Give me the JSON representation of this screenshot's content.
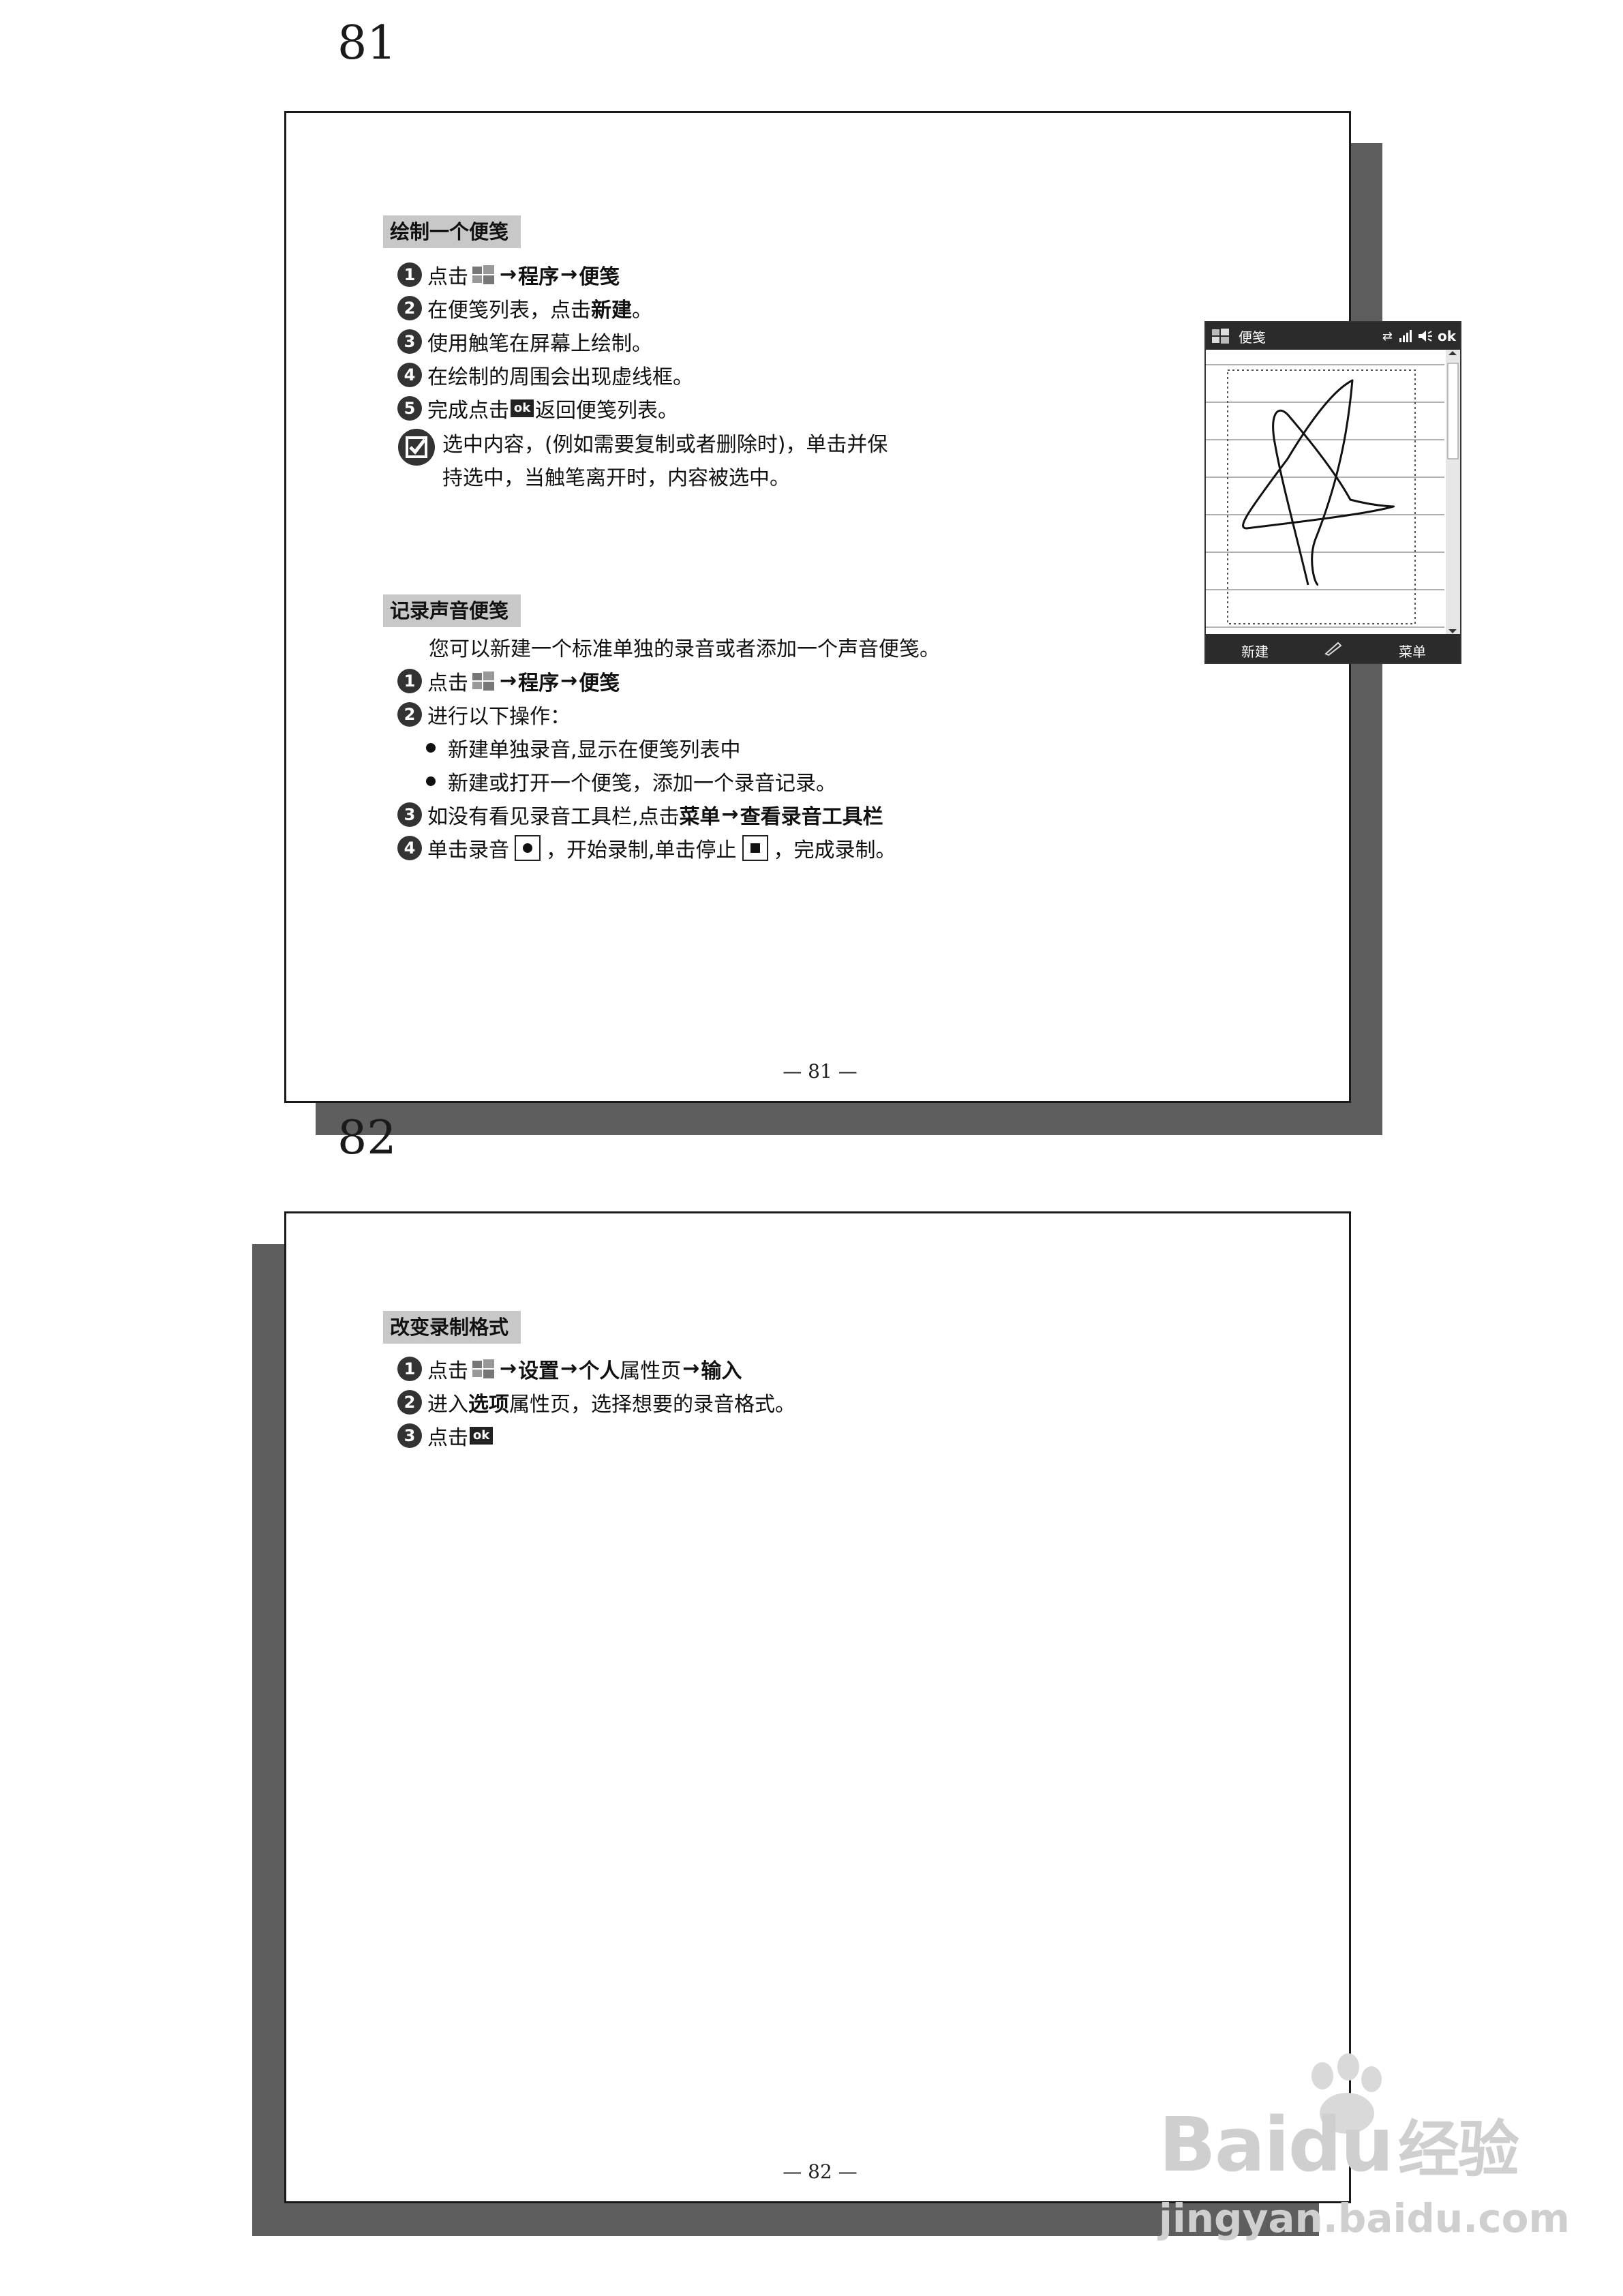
{
  "page1": {
    "label": "81",
    "footer": "— 81 —",
    "section1": {
      "title": "绘制一个便笺",
      "steps": [
        {
          "num": "1",
          "pre": "点击",
          "path1": "程序",
          "path2": "便笺"
        },
        {
          "num": "2",
          "pre": "在便笺列表，点击",
          "bold": "新建",
          "post": "。"
        },
        {
          "num": "3",
          "text": "使用触笔在屏幕上绘制。"
        },
        {
          "num": "4",
          "text": "在绘制的周围会出现虚线框。"
        },
        {
          "num": "5",
          "pre": "完成点击",
          "ok": "ok",
          "post": "返回便笺列表。"
        }
      ],
      "note_line1": "选中内容，(例如需要复制或者删除时)，单击并保",
      "note_line2": "持选中，当触笔离开时，内容被选中。"
    },
    "phone": {
      "title": "便笺",
      "status_ok": "ok",
      "left_soft": "新建",
      "right_soft": "菜单"
    },
    "section2": {
      "title": "记录声音便笺",
      "intro": "您可以新建一个标准单独的录音或者添加一个声音便笺。",
      "step1": {
        "num": "1",
        "pre": "点击",
        "path1": "程序",
        "path2": "便笺"
      },
      "step2": {
        "num": "2",
        "text": "进行以下操作："
      },
      "bullets": [
        "新建单独录音,显示在便笺列表中",
        "新建或打开一个便笺，添加一个录音记录。"
      ],
      "step3": {
        "num": "3",
        "pre": "如没有看见录音工具栏,点击",
        "b1": "菜单",
        "b2": "查看录音工具栏"
      },
      "step4": {
        "num": "4",
        "pre": "单击录音",
        "mid": "，开始录制,单击停止",
        "post": "，完成录制。"
      }
    }
  },
  "page2": {
    "label": "82",
    "footer": "— 82 —",
    "section": {
      "title": "改变录制格式",
      "step1": {
        "num": "1",
        "pre": "点击",
        "b1": "设置",
        "b2": "个人",
        "mid": "属性页",
        "b3": "输入"
      },
      "step2": {
        "num": "2",
        "pre": "进入",
        "bold": "选项",
        "post": "属性页，选择想要的录音格式。"
      },
      "step3": {
        "num": "3",
        "pre": "点击",
        "ok": "ok"
      }
    }
  },
  "arrow": "→",
  "watermark": {
    "brand": "Bai",
    "brand2": "du",
    "brand_cn": "经验",
    "url": "jingyan.baidu.com"
  },
  "colors": {
    "shadow": "#5e5e5e",
    "title_bg": "#c8c8c8",
    "number_badge": "#333333"
  }
}
